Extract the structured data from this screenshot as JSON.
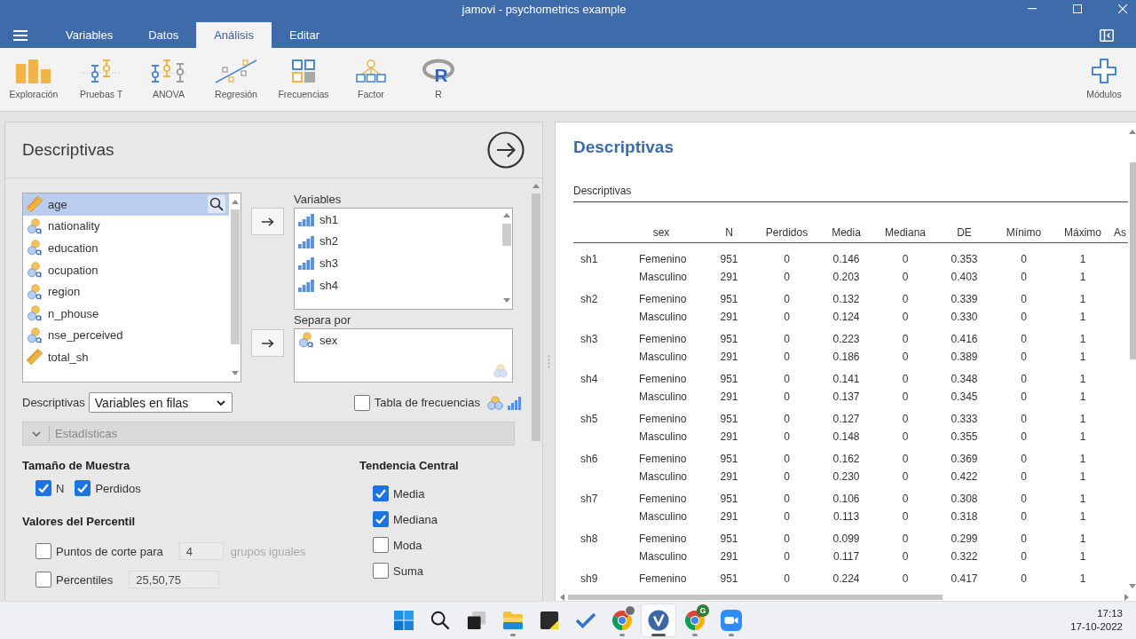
{
  "window": {
    "title": "jamovi - psychometrics example"
  },
  "menu_tabs": [
    {
      "label": "Variables",
      "selected": false
    },
    {
      "label": "Datos",
      "selected": false
    },
    {
      "label": "Análisis",
      "selected": true
    },
    {
      "label": "Editar",
      "selected": false
    }
  ],
  "ribbon": {
    "items": [
      {
        "label": "Exploración",
        "kind": "exploration"
      },
      {
        "label": "Pruebas T",
        "kind": "ttests"
      },
      {
        "label": "ANOVA",
        "kind": "anova"
      },
      {
        "label": "Regresión",
        "kind": "regression"
      },
      {
        "label": "Frecuencias",
        "kind": "frequencies"
      },
      {
        "label": "Factor",
        "kind": "factor"
      },
      {
        "label": "R",
        "kind": "rlogo",
        "logo": "R"
      }
    ],
    "modules": {
      "label": "Módulos"
    }
  },
  "options_panel": {
    "title": "Descriptivas",
    "variable_list": [
      {
        "name": "age",
        "kind": "continuous",
        "selected": true
      },
      {
        "name": "nationality",
        "kind": "nominal",
        "selected": false
      },
      {
        "name": "education",
        "kind": "nominal",
        "selected": false
      },
      {
        "name": "ocupation",
        "kind": "nominal",
        "selected": false
      },
      {
        "name": "region",
        "kind": "nominal",
        "selected": false
      },
      {
        "name": "n_phouse",
        "kind": "nominal",
        "selected": false
      },
      {
        "name": "nse_perceived",
        "kind": "nominal",
        "selected": false
      },
      {
        "name": "total_sh",
        "kind": "continuous",
        "selected": false
      }
    ],
    "variables_field": {
      "label": "Variables",
      "items": [
        {
          "name": "sh1",
          "kind": "ordinal"
        },
        {
          "name": "sh2",
          "kind": "ordinal"
        },
        {
          "name": "sh3",
          "kind": "ordinal"
        },
        {
          "name": "sh4",
          "kind": "ordinal"
        }
      ]
    },
    "split_by_field": {
      "label": "Separa por",
      "items": [
        {
          "name": "sex",
          "kind": "nominal"
        }
      ]
    },
    "layout_select": {
      "label": "Descriptivas",
      "value": "Variables en filas"
    },
    "frequency_tables": {
      "label": "Tabla de frecuencias",
      "checked": false
    },
    "statistics_section": {
      "label": "Estadísticas",
      "expanded": true
    },
    "sample_size": {
      "heading": "Tamaño de Muestra",
      "options": [
        {
          "label": "N",
          "checked": true
        },
        {
          "label": "Perdidos",
          "checked": true
        }
      ]
    },
    "percentile_values": {
      "heading": "Valores del Percentil",
      "options": [
        {
          "label": "Puntos de corte para",
          "checked": false,
          "value": "4",
          "suffix": "grupos iguales"
        },
        {
          "label": "Percentiles",
          "checked": false,
          "value": "25,50,75"
        }
      ]
    },
    "central_tendency": {
      "heading": "Tendencia Central",
      "options": [
        {
          "label": "Media",
          "checked": true
        },
        {
          "label": "Mediana",
          "checked": true
        },
        {
          "label": "Moda",
          "checked": false
        },
        {
          "label": "Suma",
          "checked": false
        }
      ]
    }
  },
  "results": {
    "title": "Descriptivas",
    "table": {
      "title": "Descriptivas",
      "columns": [
        "sex",
        "N",
        "Perdidos",
        "Media",
        "Mediana",
        "DE",
        "Mínimo",
        "Máximo",
        "As"
      ],
      "rows": [
        {
          "variable": "sh1",
          "groups": [
            {
              "sex": "Femenino",
              "values": [
                "951",
                "0",
                "0.146",
                "0",
                "0.353",
                "0",
                "1"
              ]
            },
            {
              "sex": "Masculino",
              "values": [
                "291",
                "0",
                "0.203",
                "0",
                "0.403",
                "0",
                "1"
              ]
            }
          ]
        },
        {
          "variable": "sh2",
          "groups": [
            {
              "sex": "Femenino",
              "values": [
                "951",
                "0",
                "0.132",
                "0",
                "0.339",
                "0",
                "1"
              ]
            },
            {
              "sex": "Masculino",
              "values": [
                "291",
                "0",
                "0.124",
                "0",
                "0.330",
                "0",
                "1"
              ]
            }
          ]
        },
        {
          "variable": "sh3",
          "groups": [
            {
              "sex": "Femenino",
              "values": [
                "951",
                "0",
                "0.223",
                "0",
                "0.416",
                "0",
                "1"
              ]
            },
            {
              "sex": "Masculino",
              "values": [
                "291",
                "0",
                "0.186",
                "0",
                "0.389",
                "0",
                "1"
              ]
            }
          ]
        },
        {
          "variable": "sh4",
          "groups": [
            {
              "sex": "Femenino",
              "values": [
                "951",
                "0",
                "0.141",
                "0",
                "0.348",
                "0",
                "1"
              ]
            },
            {
              "sex": "Masculino",
              "values": [
                "291",
                "0",
                "0.137",
                "0",
                "0.345",
                "0",
                "1"
              ]
            }
          ]
        },
        {
          "variable": "sh5",
          "groups": [
            {
              "sex": "Femenino",
              "values": [
                "951",
                "0",
                "0.127",
                "0",
                "0.333",
                "0",
                "1"
              ]
            },
            {
              "sex": "Masculino",
              "values": [
                "291",
                "0",
                "0.148",
                "0",
                "0.355",
                "0",
                "1"
              ]
            }
          ]
        },
        {
          "variable": "sh6",
          "groups": [
            {
              "sex": "Femenino",
              "values": [
                "951",
                "0",
                "0.162",
                "0",
                "0.369",
                "0",
                "1"
              ]
            },
            {
              "sex": "Masculino",
              "values": [
                "291",
                "0",
                "0.230",
                "0",
                "0.422",
                "0",
                "1"
              ]
            }
          ]
        },
        {
          "variable": "sh7",
          "groups": [
            {
              "sex": "Femenino",
              "values": [
                "951",
                "0",
                "0.106",
                "0",
                "0.308",
                "0",
                "1"
              ]
            },
            {
              "sex": "Masculino",
              "values": [
                "291",
                "0",
                "0.113",
                "0",
                "0.318",
                "0",
                "1"
              ]
            }
          ]
        },
        {
          "variable": "sh8",
          "groups": [
            {
              "sex": "Femenino",
              "values": [
                "951",
                "0",
                "0.099",
                "0",
                "0.299",
                "0",
                "1"
              ]
            },
            {
              "sex": "Masculino",
              "values": [
                "291",
                "0",
                "0.117",
                "0",
                "0.322",
                "0",
                "1"
              ]
            }
          ]
        },
        {
          "variable": "sh9",
          "groups": [
            {
              "sex": "Femenino",
              "values": [
                "951",
                "0",
                "0.224",
                "0",
                "0.417",
                "0",
                "1"
              ]
            }
          ]
        }
      ]
    }
  },
  "taskbar": {
    "apps": [
      {
        "kind": "start",
        "running": false,
        "selected": false
      },
      {
        "kind": "search",
        "running": false,
        "selected": false
      },
      {
        "kind": "task_view",
        "running": false,
        "selected": false
      },
      {
        "kind": "file_explorer",
        "running": true,
        "selected": false
      },
      {
        "kind": "sticky_notes",
        "running": false,
        "selected": false
      },
      {
        "kind": "todo",
        "running": false,
        "selected": false
      },
      {
        "kind": "browser",
        "running": true,
        "selected": false,
        "badge": {
          "kind": "photo"
        }
      },
      {
        "kind": "jamovi",
        "running": true,
        "selected": true
      },
      {
        "kind": "browser",
        "running": true,
        "selected": false,
        "badge": {
          "kind": "letter",
          "text": "G"
        }
      },
      {
        "kind": "zoom",
        "running": true,
        "selected": false
      }
    ],
    "time": "17:13",
    "date": "17-10-2022"
  }
}
